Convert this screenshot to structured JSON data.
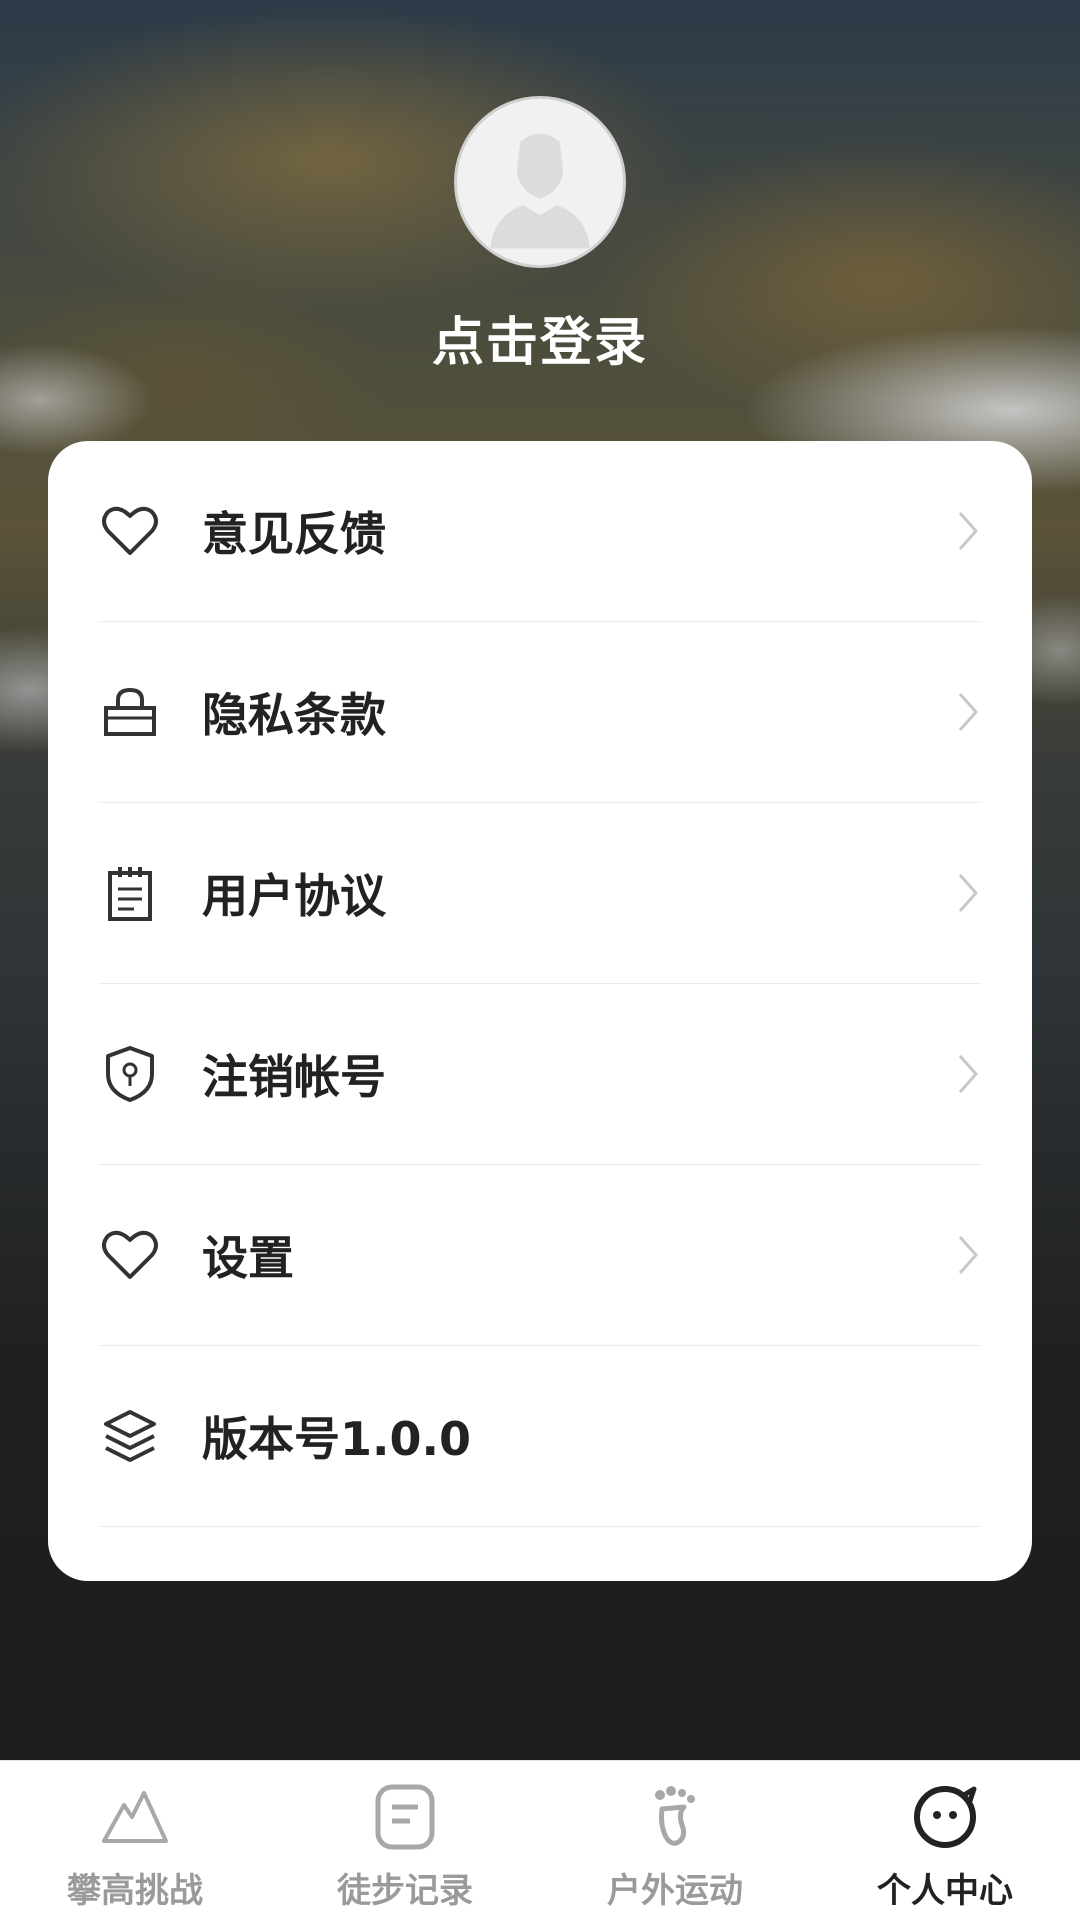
{
  "header": {
    "login_text": "点击登录"
  },
  "menu": {
    "items": [
      {
        "label": "意见反馈",
        "icon": "heart-icon",
        "has_chevron": true
      },
      {
        "label": "隐私条款",
        "icon": "bag-lock-icon",
        "has_chevron": true
      },
      {
        "label": "用户协议",
        "icon": "notepad-icon",
        "has_chevron": true
      },
      {
        "label": "注销帐号",
        "icon": "shield-key-icon",
        "has_chevron": true
      },
      {
        "label": "设置",
        "icon": "heart-icon",
        "has_chevron": true
      },
      {
        "label": "版本号1.0.0",
        "icon": "layers-icon",
        "has_chevron": false
      }
    ]
  },
  "tabbar": {
    "tabs": [
      {
        "label": "攀高挑战",
        "icon": "mountain-icon",
        "active": false
      },
      {
        "label": "徒步记录",
        "icon": "note-icon",
        "active": false
      },
      {
        "label": "户外运动",
        "icon": "footprint-icon",
        "active": false
      },
      {
        "label": "个人中心",
        "icon": "smiley-face-icon",
        "active": true
      }
    ]
  },
  "colors": {
    "card_bg": "#ffffff",
    "text_primary": "#222222",
    "tab_inactive": "#9a9a9a",
    "page_bg": "#1e1e1e"
  }
}
